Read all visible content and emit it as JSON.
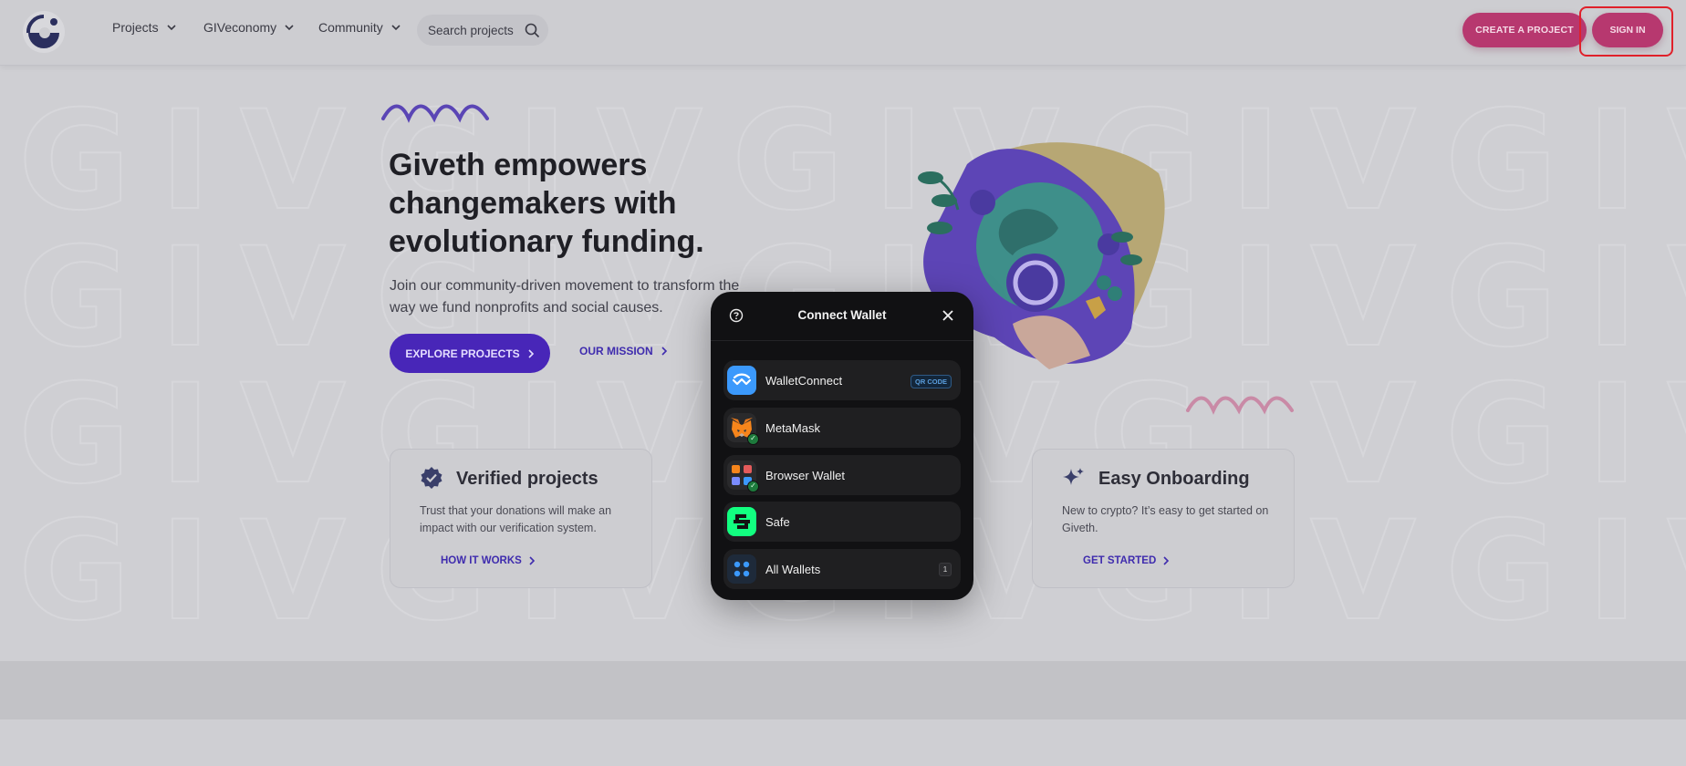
{
  "header": {
    "nav": [
      {
        "label": "Projects"
      },
      {
        "label": "GIVeconomy"
      },
      {
        "label": "Community"
      }
    ],
    "search_placeholder": "Search projects",
    "create_label": "CREATE A PROJECT",
    "signin_label": "SIGN IN"
  },
  "hero": {
    "title": "Giveth empowers changemakers with evolutionary funding.",
    "subtitle": "Join our community-driven movement to transform the way we fund nonprofits and social causes.",
    "explore_label": "EXPLORE PROJECTS",
    "mission_label": "OUR MISSION"
  },
  "cards": [
    {
      "title": "Verified projects",
      "text": "Trust that your donations will make an impact with our verification system.",
      "link": "HOW IT WORKS",
      "icon": "verified-badge-icon"
    },
    {
      "title": "Easy Onboarding",
      "text": "New to crypto? It’s easy to get started on Giveth.",
      "link": "GET STARTED",
      "icon": "sparkle-icon"
    }
  ],
  "modal": {
    "title": "Connect Wallet",
    "wallets": [
      {
        "label": "WalletConnect",
        "badge": "QR CODE",
        "icon": "walletconnect-icon"
      },
      {
        "label": "MetaMask",
        "icon": "metamask-icon"
      },
      {
        "label": "Browser Wallet",
        "icon": "browser-wallet-icon"
      },
      {
        "label": "Safe",
        "icon": "safe-icon"
      },
      {
        "label": "All Wallets",
        "count": "1",
        "icon": "all-wallets-icon"
      }
    ]
  },
  "colors": {
    "brand_pink": "#b7386f",
    "brand_purple": "#4826b8",
    "highlight_red": "#e0202a"
  }
}
